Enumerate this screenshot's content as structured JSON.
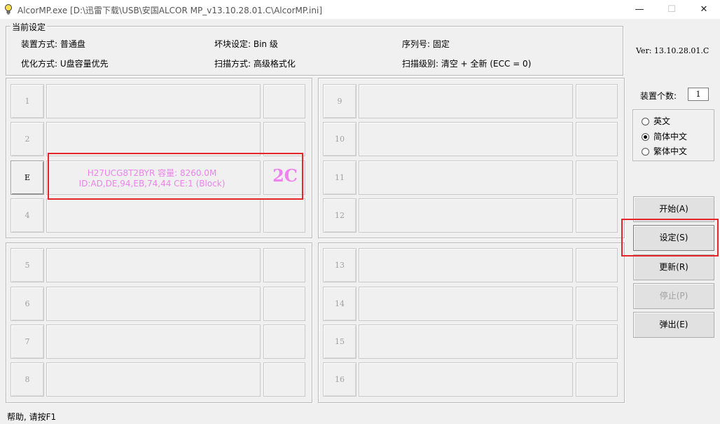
{
  "window": {
    "title": "AlcorMP.exe [D:\\迅雷下载\\USB\\安国ALCOR MP_v13.10.28.01.C\\AlcorMP.ini]",
    "minimize_label": "—",
    "maximize_label": "☐",
    "close_label": "✕"
  },
  "settings": {
    "legend": "当前设定",
    "device_mode": "装置方式: 普通盘",
    "bad_block": "坏块设定: Bin 级",
    "serial": "序列号: 固定",
    "optimize": "优化方式: U盘容量优先",
    "scan_mode": "扫描方式: 高级格式化",
    "scan_level": "扫描级别: 清空 + 全新 (ECC = 0)"
  },
  "version": "Ver: 13.10.28.01.C",
  "device_count": {
    "label": "装置个数:",
    "value": "1"
  },
  "language": {
    "options": [
      {
        "label": "英文",
        "selected": false
      },
      {
        "label": "简体中文",
        "selected": true
      },
      {
        "label": "繁体中文",
        "selected": false
      }
    ]
  },
  "buttons": {
    "start": "开始(A)",
    "settings": "设定(S)",
    "refresh": "更新(R)",
    "stop": "停止(P)",
    "eject": "弹出(E)"
  },
  "ports": {
    "p1": "1",
    "p2": "2",
    "p3": "E",
    "p4": "4",
    "p5": "5",
    "p6": "6",
    "p7": "7",
    "p8": "8",
    "p9": "9",
    "p10": "10",
    "p11": "11",
    "p12": "12",
    "p13": "13",
    "p14": "14",
    "p15": "15",
    "p16": "16"
  },
  "device": {
    "line1": "H27UCG8T2BYR 容量: 8260.0M",
    "line2": "ID:AD,DE,94,EB,74,44 CE:1 (Block)",
    "code": "2C"
  },
  "colors": {
    "highlight": "#e8242b",
    "device_text": "#ee82ee"
  },
  "status": "帮助, 请按F1"
}
